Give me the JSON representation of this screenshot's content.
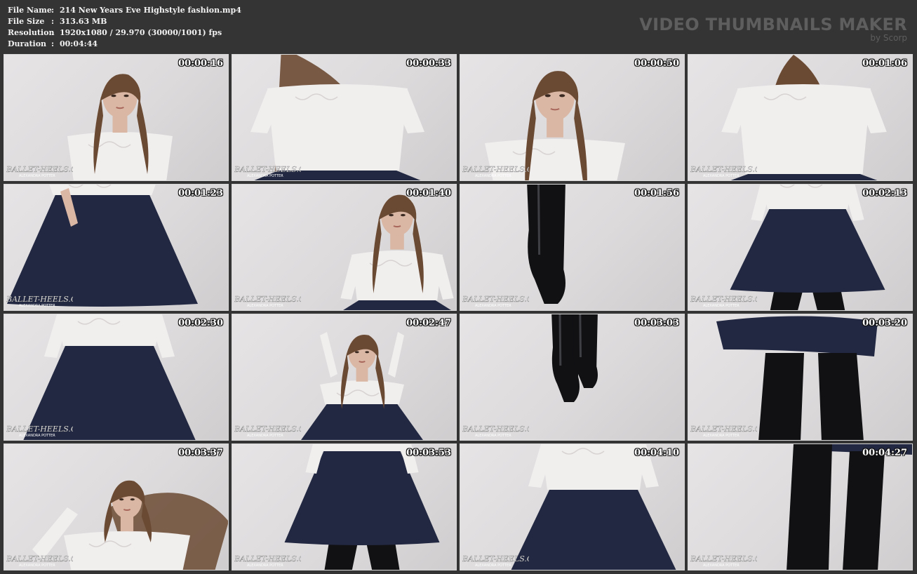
{
  "file_info": {
    "rows": [
      {
        "key": "File Name",
        "value": "214 New Years Eve Highstyle fashion.mp4"
      },
      {
        "key": "File Size",
        "value": "313.63 MB"
      },
      {
        "key": "Resolution",
        "value": "1920x1080 / 29.970 (30000/1001) fps"
      },
      {
        "key": "Duration",
        "value": "00:04:44"
      }
    ],
    "separator": ":"
  },
  "brand": {
    "title": "VIDEO THUMBNAILS MAKER",
    "subtitle": "by Scorp"
  },
  "watermark": {
    "text": "BALLET-HEELS.COM",
    "subtext": "ALEXANDRA POTTER"
  },
  "thumbnails": [
    {
      "time": "00:00:16",
      "scene": "portrait-face-left"
    },
    {
      "time": "00:00:33",
      "scene": "torso-lace"
    },
    {
      "time": "00:00:50",
      "scene": "portrait-face-center"
    },
    {
      "time": "00:01:06",
      "scene": "back-hair-toss"
    },
    {
      "time": "00:01:23",
      "scene": "skirt-hand-hip"
    },
    {
      "time": "00:01:40",
      "scene": "portrait-full-right"
    },
    {
      "time": "00:01:56",
      "scene": "boot-closeup"
    },
    {
      "time": "00:02:13",
      "scene": "skirt-legs"
    },
    {
      "time": "00:02:30",
      "scene": "torso-turn"
    },
    {
      "time": "00:02:47",
      "scene": "arms-up"
    },
    {
      "time": "00:03:03",
      "scene": "boots-walking"
    },
    {
      "time": "00:03:20",
      "scene": "skirt-lift-legs"
    },
    {
      "time": "00:03:37",
      "scene": "hair-motion"
    },
    {
      "time": "00:03:53",
      "scene": "skirt-walk"
    },
    {
      "time": "00:04:10",
      "scene": "torso-back"
    },
    {
      "time": "00:04:27",
      "scene": "legs-latex"
    }
  ],
  "colors": {
    "background": "#343434",
    "lace": "#f1eeee",
    "skirt": "#222842",
    "hair": "#6b4a33",
    "skin": "#d9b7a4",
    "latex": "#111114"
  }
}
